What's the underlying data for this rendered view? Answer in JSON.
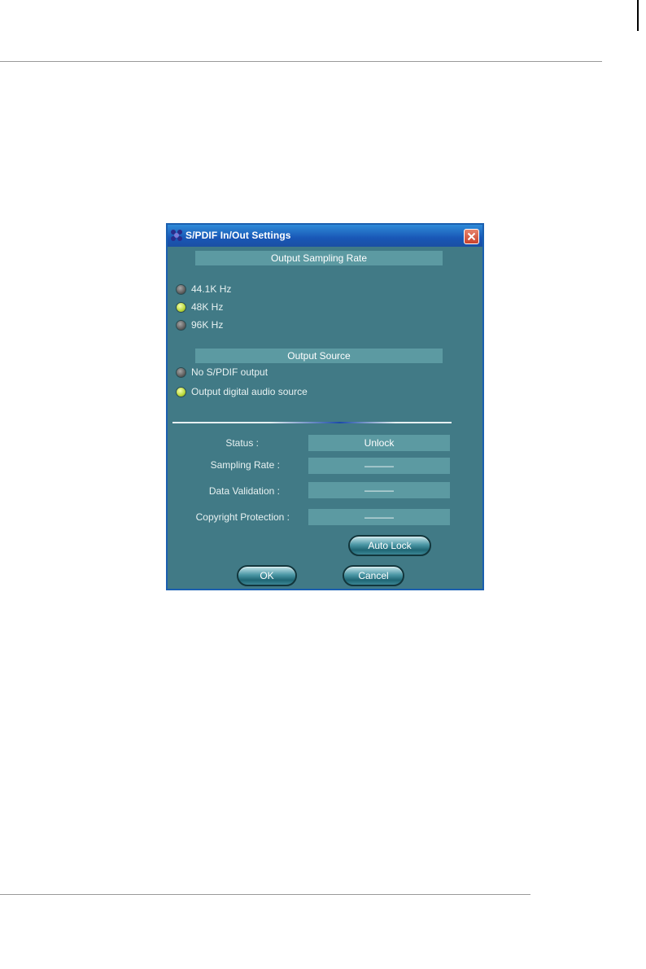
{
  "window": {
    "title": "S/PDIF In/Out Settings"
  },
  "sampling_rate": {
    "header": "Output Sampling Rate",
    "options": [
      {
        "label": "44.1K Hz",
        "selected": false
      },
      {
        "label": "48K Hz",
        "selected": true
      },
      {
        "label": "96K Hz",
        "selected": false
      }
    ]
  },
  "output_source": {
    "header": "Output Source",
    "options": [
      {
        "label": "No S/PDIF output",
        "selected": false
      },
      {
        "label": "Output digital audio source",
        "selected": true
      }
    ]
  },
  "status": {
    "status_label": "Status :",
    "status_value": "Unlock",
    "sampling_rate_label": "Sampling Rate :",
    "sampling_rate_value": "———",
    "data_validation_label": "Data Validation :",
    "data_validation_value": "———",
    "copyright_label": "Copyright Protection :",
    "copyright_value": "———"
  },
  "buttons": {
    "auto_lock": "Auto Lock",
    "ok": "OK",
    "cancel": "Cancel"
  },
  "colors": {
    "dialog_bg": "#417a86",
    "header_bg": "#5c9aa2",
    "titlebar": "#1957b6",
    "radio_on": "#b9d83a"
  }
}
